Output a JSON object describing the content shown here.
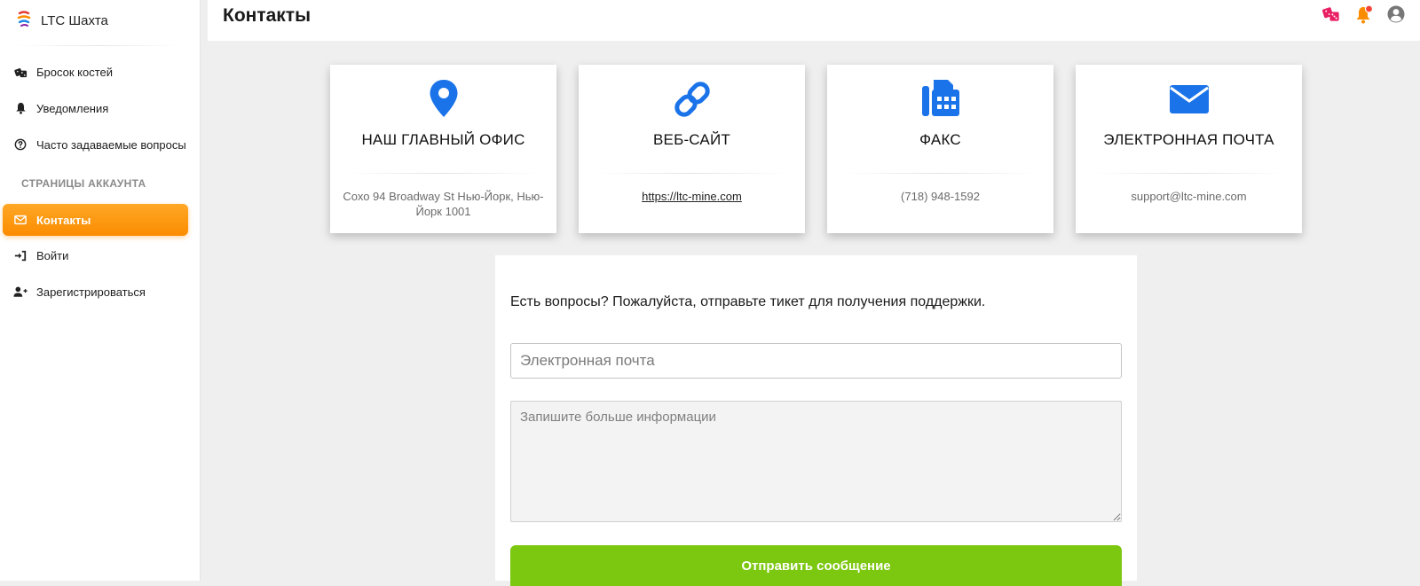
{
  "app": {
    "title": "LTC Шахта"
  },
  "sidebar": {
    "items": [
      {
        "label": "Бросок костей",
        "icon": "dice-icon"
      },
      {
        "label": "Уведомления",
        "icon": "bell-icon"
      },
      {
        "label": "Часто задаваемые вопросы",
        "icon": "question-circle-icon"
      }
    ],
    "section_title": "СТРАНИЦЫ АККАУНТА",
    "account_items": [
      {
        "label": "Контакты",
        "icon": "envelope-icon",
        "active": true
      },
      {
        "label": "Войти",
        "icon": "sign-in-icon"
      },
      {
        "label": "Зарегистрироваться",
        "icon": "user-plus-icon"
      }
    ]
  },
  "header": {
    "title": "Контакты",
    "icons": [
      "dice-icon",
      "bell-icon",
      "user-circle-icon"
    ]
  },
  "cards": [
    {
      "title": "НАШ ГЛАВНЫЙ ОФИС",
      "value": "Сохо 94 Broadway St Нью-Йорк, Нью-Йорк 1001",
      "icon": "map-pin-icon"
    },
    {
      "title": "ВЕБ-САЙТ",
      "value": "https://ltc-mine.com",
      "icon": "link-icon"
    },
    {
      "title": "ФАКС",
      "value": "(718) 948-1592",
      "icon": "fax-icon"
    },
    {
      "title": "ЭЛЕКТРОННАЯ ПОЧТА",
      "value": "support@ltc-mine.com",
      "icon": "envelope-icon"
    }
  ],
  "form": {
    "heading": "Есть вопросы? Пожалуйста, отправьте тикет для получения поддержки.",
    "email_placeholder": "Электронная почта",
    "message_placeholder": "Запишите больше информации",
    "submit_label": "Отправить сообщение"
  },
  "colors": {
    "accent_orange": "#fb8c00",
    "icon_blue": "#1a73e8",
    "submit_green": "#7cc70f",
    "dice_pink": "#e91e63"
  }
}
